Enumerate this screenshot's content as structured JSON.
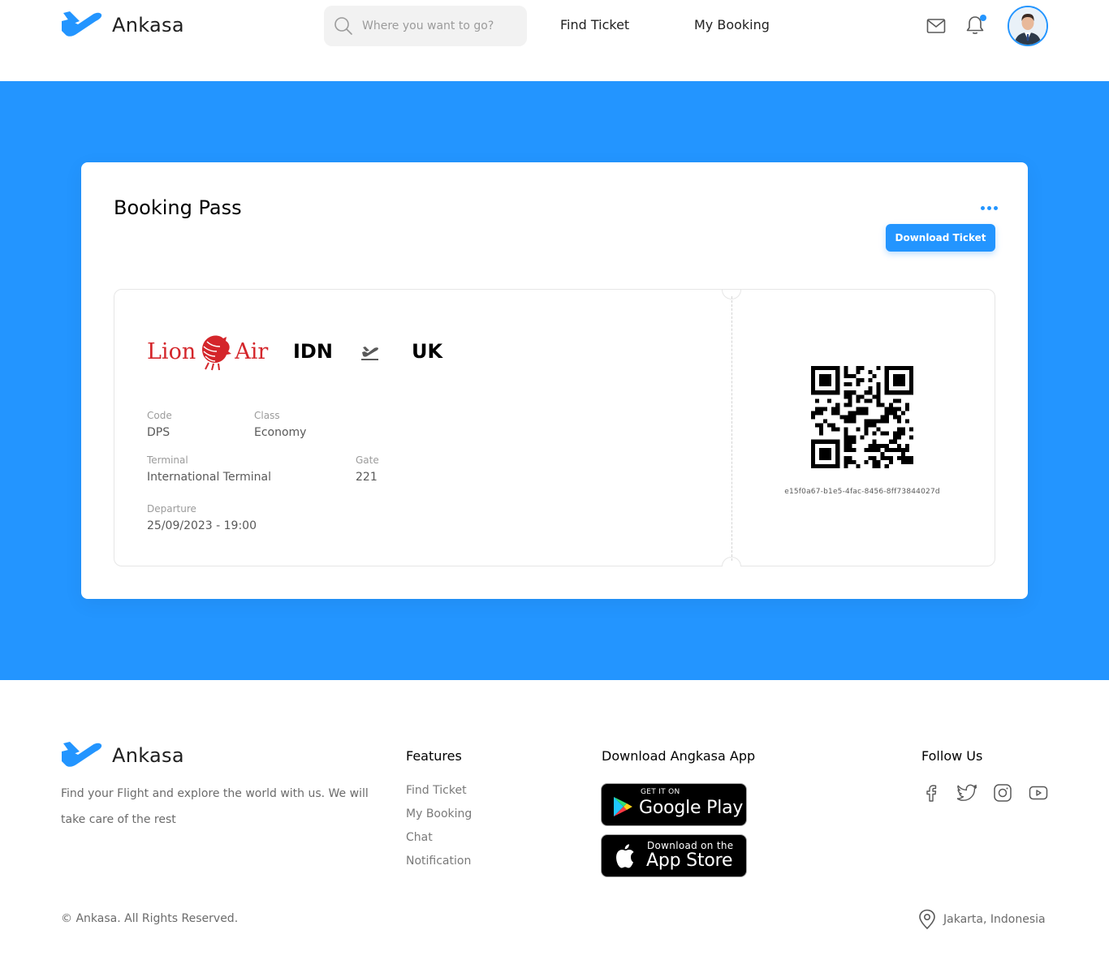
{
  "header": {
    "brand": "Ankasa",
    "search_placeholder": "Where you want to go?",
    "nav": [
      "Find Ticket",
      "My Booking"
    ],
    "icons": [
      "mail-icon",
      "bell-icon"
    ],
    "accent_color": "#2395ff"
  },
  "booking": {
    "title": "Booking Pass",
    "download_label": "Download Ticket",
    "airline_logo": {
      "text_left": "Lion",
      "text_right": "Air",
      "color": "#d4262b"
    },
    "from": "IDN",
    "to": "UK",
    "fields": {
      "code_label": "Code",
      "code_value": "DPS",
      "class_label": "Class",
      "class_value": "Economy",
      "terminal_label": "Terminal",
      "terminal_value": "International Terminal",
      "gate_label": "Gate",
      "gate_value": "221",
      "departure_label": "Departure",
      "departure_value": "25/09/2023 - 19:00"
    },
    "booking_id": "e15f0a67-b1e5-4fac-8456-8ff73844027d"
  },
  "footer": {
    "brand": "Ankasa",
    "description": "Find your Flight and explore the world with us. We will take care of the rest",
    "features_heading": "Features",
    "features": [
      "Find Ticket",
      "My Booking",
      "Chat",
      "Notification"
    ],
    "download_heading": "Download Angkasa App",
    "google_play": {
      "small": "GET IT ON",
      "big": "Google Play"
    },
    "app_store": {
      "small": "Download on the",
      "big": "App Store"
    },
    "follow_heading": "Follow Us",
    "social": [
      "facebook-icon",
      "twitter-icon",
      "instagram-icon",
      "youtube-icon"
    ],
    "copyright": "© Ankasa. All Rights Reserved.",
    "location": "Jakarta, Indonesia"
  }
}
